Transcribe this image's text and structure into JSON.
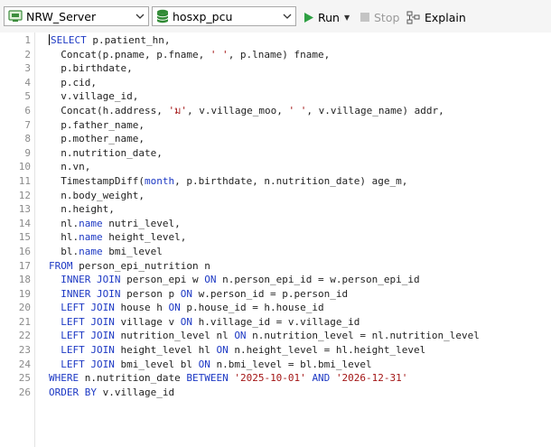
{
  "toolbar": {
    "connection": "NRW_Server",
    "database": "hosxp_pcu",
    "run_label": "Run",
    "stop_label": "Stop",
    "explain_label": "Explain",
    "colors": {
      "run": "#2ea043",
      "database": "#2f8a34",
      "stop": "#c4c4c4"
    }
  },
  "editor": {
    "line_numbers": [
      "1",
      "2",
      "3",
      "4",
      "5",
      "6",
      "7",
      "8",
      "9",
      "10",
      "11",
      "12",
      "13",
      "14",
      "15",
      "16",
      "17",
      "18",
      "19",
      "20",
      "21",
      "22",
      "23",
      "24",
      "25",
      "26"
    ],
    "lines": [
      [
        {
          "t": "SELECT",
          "c": "kw"
        },
        {
          "t": " p.patient_hn,"
        }
      ],
      [
        {
          "t": "  Concat(p.pname, p.fname, "
        },
        {
          "t": "' '",
          "c": "str"
        },
        {
          "t": ", p.lname) fname,"
        }
      ],
      [
        {
          "t": "  p.birthdate,"
        }
      ],
      [
        {
          "t": "  p.cid,"
        }
      ],
      [
        {
          "t": "  v.village_id,"
        }
      ],
      [
        {
          "t": "  Concat(h.address, "
        },
        {
          "t": "'ม'",
          "c": "str"
        },
        {
          "t": ", v.village_moo, "
        },
        {
          "t": "' '",
          "c": "str"
        },
        {
          "t": ", v.village_name) addr,"
        }
      ],
      [
        {
          "t": "  p.father_name,"
        }
      ],
      [
        {
          "t": "  p.mother_name,"
        }
      ],
      [
        {
          "t": "  n.nutrition_date,"
        }
      ],
      [
        {
          "t": "  n.vn,"
        }
      ],
      [
        {
          "t": "  TimestampDiff("
        },
        {
          "t": "month",
          "c": "kw"
        },
        {
          "t": ", p.birthdate, n.nutrition_date) age_m,"
        }
      ],
      [
        {
          "t": "  n.body_weight,"
        }
      ],
      [
        {
          "t": "  n.height,"
        }
      ],
      [
        {
          "t": "  nl."
        },
        {
          "t": "name",
          "c": "kw"
        },
        {
          "t": " nutri_level,"
        }
      ],
      [
        {
          "t": "  hl."
        },
        {
          "t": "name",
          "c": "kw"
        },
        {
          "t": " height_level,"
        }
      ],
      [
        {
          "t": "  bl."
        },
        {
          "t": "name",
          "c": "kw"
        },
        {
          "t": " bmi_level"
        }
      ],
      [
        {
          "t": "FROM",
          "c": "kw"
        },
        {
          "t": " person_epi_nutrition n"
        }
      ],
      [
        {
          "t": "  "
        },
        {
          "t": "INNER JOIN",
          "c": "kw"
        },
        {
          "t": " person_epi w "
        },
        {
          "t": "ON",
          "c": "kw"
        },
        {
          "t": " n.person_epi_id = w.person_epi_id"
        }
      ],
      [
        {
          "t": "  "
        },
        {
          "t": "INNER JOIN",
          "c": "kw"
        },
        {
          "t": " person p "
        },
        {
          "t": "ON",
          "c": "kw"
        },
        {
          "t": " w.person_id = p.person_id"
        }
      ],
      [
        {
          "t": "  "
        },
        {
          "t": "LEFT JOIN",
          "c": "kw"
        },
        {
          "t": " house h "
        },
        {
          "t": "ON",
          "c": "kw"
        },
        {
          "t": " p.house_id = h.house_id"
        }
      ],
      [
        {
          "t": "  "
        },
        {
          "t": "LEFT JOIN",
          "c": "kw"
        },
        {
          "t": " village v "
        },
        {
          "t": "ON",
          "c": "kw"
        },
        {
          "t": " h.village_id = v.village_id"
        }
      ],
      [
        {
          "t": "  "
        },
        {
          "t": "LEFT JOIN",
          "c": "kw"
        },
        {
          "t": " nutrition_level nl "
        },
        {
          "t": "ON",
          "c": "kw"
        },
        {
          "t": " n.nutrition_level = nl.nutrition_level"
        }
      ],
      [
        {
          "t": "  "
        },
        {
          "t": "LEFT JOIN",
          "c": "kw"
        },
        {
          "t": " height_level hl "
        },
        {
          "t": "ON",
          "c": "kw"
        },
        {
          "t": " n.height_level = hl.height_level"
        }
      ],
      [
        {
          "t": "  "
        },
        {
          "t": "LEFT JOIN",
          "c": "kw"
        },
        {
          "t": " bmi_level bl "
        },
        {
          "t": "ON",
          "c": "kw"
        },
        {
          "t": " n.bmi_level = bl.bmi_level"
        }
      ],
      [
        {
          "t": "WHERE",
          "c": "kw"
        },
        {
          "t": " n.nutrition_date "
        },
        {
          "t": "BETWEEN",
          "c": "kw"
        },
        {
          "t": " "
        },
        {
          "t": "'2025-10-01'",
          "c": "str"
        },
        {
          "t": " "
        },
        {
          "t": "AND",
          "c": "kw"
        },
        {
          "t": " "
        },
        {
          "t": "'2026-12-31'",
          "c": "str"
        }
      ],
      [
        {
          "t": "ORDER BY",
          "c": "kw"
        },
        {
          "t": " v.village_id"
        }
      ]
    ]
  }
}
